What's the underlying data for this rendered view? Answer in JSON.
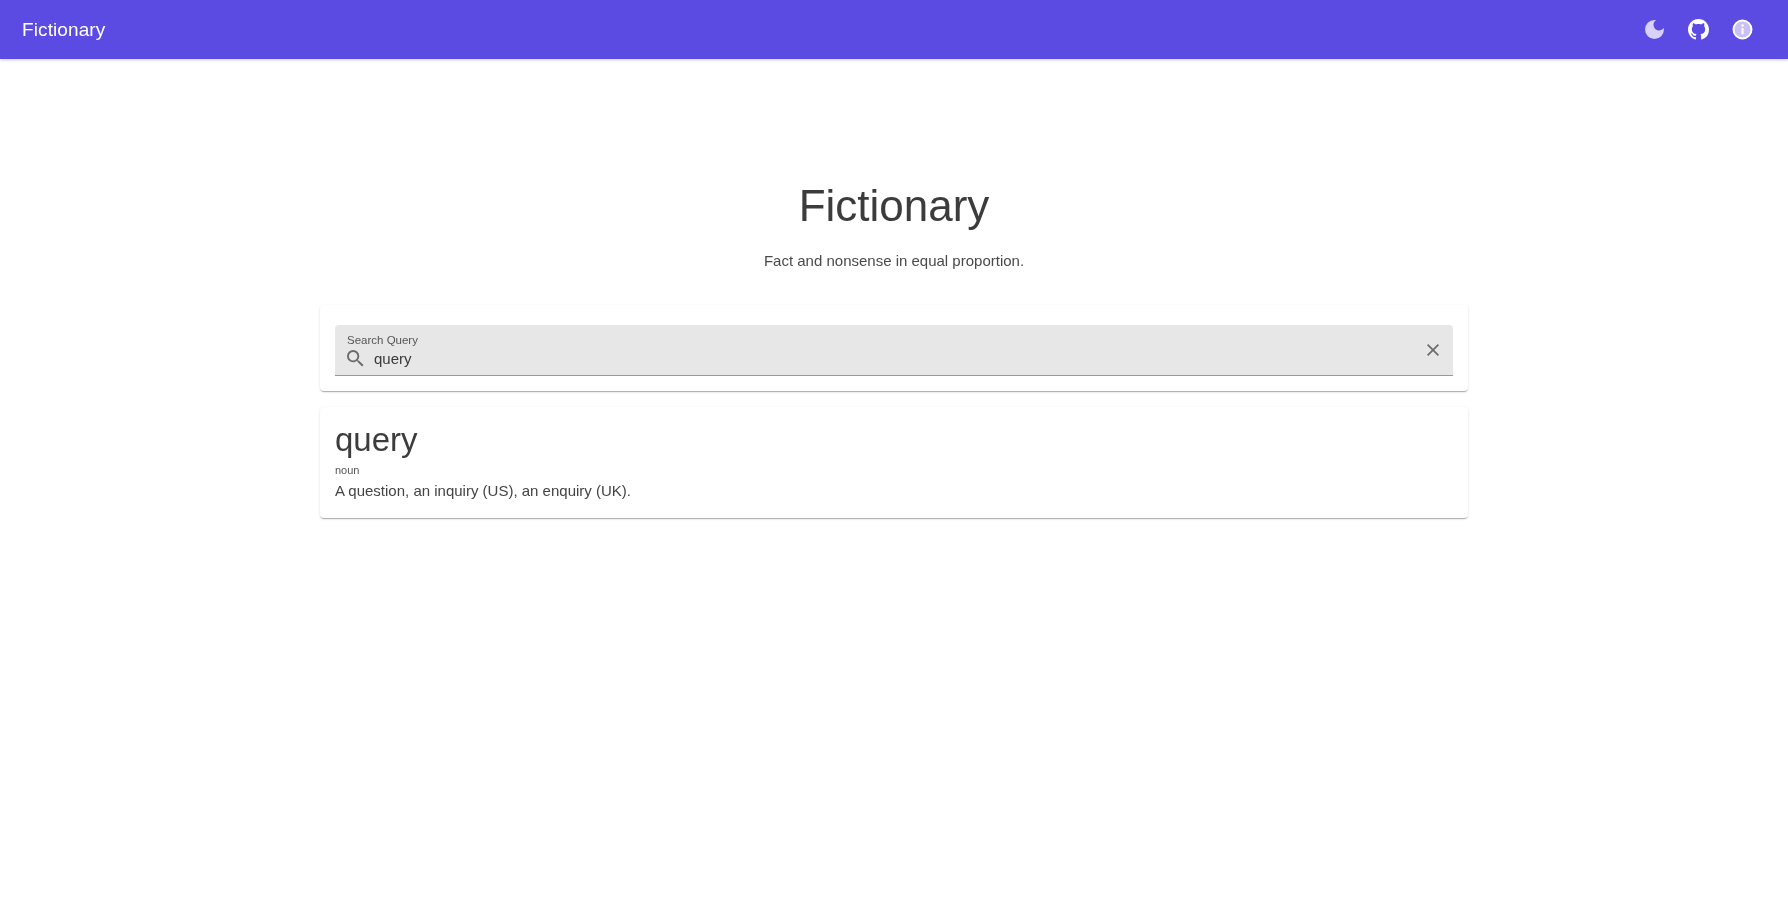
{
  "app_bar": {
    "title": "Fictionary"
  },
  "hero": {
    "title": "Fictionary",
    "subtitle": "Fact and nonsense in equal proportion."
  },
  "search": {
    "label": "Search Query",
    "value": "query"
  },
  "results": [
    {
      "word": "query",
      "part_of_speech": "noun",
      "definition": "A question, an inquiry (US), an enquiry (UK)."
    }
  ]
}
